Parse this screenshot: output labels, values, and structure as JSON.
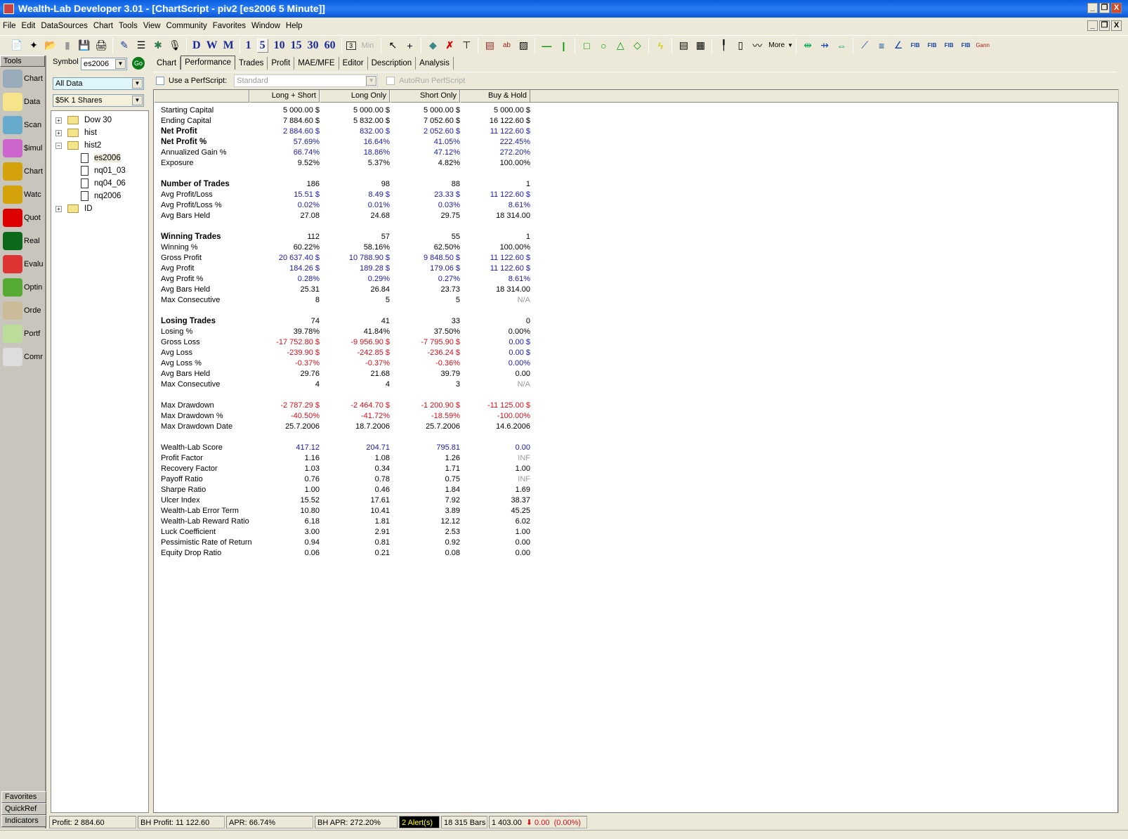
{
  "window": {
    "title": "Wealth-Lab Developer 3.01 - [ChartScript - piv2 [es2006 5 Minute]]",
    "min": "_",
    "restore": "❐",
    "close": "X"
  },
  "menu": [
    "File",
    "Edit",
    "DataSources",
    "Chart",
    "Tools",
    "View",
    "Community",
    "Favorites",
    "Window",
    "Help"
  ],
  "toolbar": {
    "timeframes": [
      "D",
      "W",
      "M",
      "1",
      "5",
      "10",
      "15",
      "30",
      "60"
    ],
    "min_label": "Min",
    "min_value": "3",
    "more_label": "More",
    "fib": "FIB",
    "gann": "Gann"
  },
  "tools": {
    "header": "Tools",
    "items": [
      "Chart",
      "Data",
      "Scan",
      "$imul",
      "Chart",
      "Watc",
      "Quot",
      "Real",
      "Evalu",
      "Optin",
      "Orde",
      "Portf",
      "Comr"
    ],
    "bottom": [
      "Favorites",
      "QuickRef",
      "Indicators"
    ]
  },
  "sidebar": {
    "symbol_label": "Symbol",
    "symbol_value": "es2006",
    "go": "Go",
    "range": "All Data",
    "sizing": "$5K 1 Shares",
    "tree": [
      {
        "label": "Dow 30",
        "type": "folder",
        "exp": "+"
      },
      {
        "label": "hist",
        "type": "folder",
        "exp": "+"
      },
      {
        "label": "hist2",
        "type": "folder",
        "exp": "−"
      },
      {
        "label": "es2006",
        "type": "doc"
      },
      {
        "label": "nq01_03",
        "type": "doc"
      },
      {
        "label": "nq04_06",
        "type": "doc"
      },
      {
        "label": "nq2006",
        "type": "doc"
      },
      {
        "label": "ID",
        "type": "folder",
        "exp": "+"
      }
    ]
  },
  "tabs": [
    "Chart",
    "Performance",
    "Trades",
    "Profit",
    "MAE/MFE",
    "Editor",
    "Description",
    "Analysis"
  ],
  "perfscript": {
    "label": "Use a PerfScript:",
    "value": "Standard",
    "autorun": "AutoRun PerfScript"
  },
  "columns": [
    "Long + Short",
    "Long Only",
    "Short Only",
    "Buy & Hold"
  ],
  "rows": [
    {
      "label": "Starting Capital",
      "vals": [
        "5 000.00 $",
        "5 000.00 $",
        "5 000.00 $",
        "5 000.00 $"
      ]
    },
    {
      "label": "Ending Capital",
      "vals": [
        "7 884.60 $",
        "5 832.00 $",
        "7 052.60 $",
        "16 122.60 $"
      ]
    },
    {
      "label": "Net Profit",
      "bold": true,
      "c": "blue",
      "vals": [
        "2 884.60 $",
        "832.00 $",
        "2 052.60 $",
        "11 122.60 $"
      ]
    },
    {
      "label": "Net Profit %",
      "bold": true,
      "c": "blue",
      "vals": [
        "57.69%",
        "16.64%",
        "41.05%",
        "222.45%"
      ]
    },
    {
      "label": "Annualized Gain %",
      "c": "blue",
      "vals": [
        "66.74%",
        "18.86%",
        "47.12%",
        "272.20%"
      ]
    },
    {
      "label": "Exposure",
      "vals": [
        "9.52%",
        "5.37%",
        "4.82%",
        "100.00%"
      ]
    },
    null,
    {
      "label": "Number of Trades",
      "bold": true,
      "vals": [
        "186",
        "98",
        "88",
        "1"
      ]
    },
    {
      "label": "Avg Profit/Loss",
      "c": "blue",
      "vals": [
        "15.51 $",
        "8.49 $",
        "23.33 $",
        "11 122.60 $"
      ]
    },
    {
      "label": "Avg Profit/Loss %",
      "c": "blue",
      "vals": [
        "0.02%",
        "0.01%",
        "0.03%",
        "8.61%"
      ]
    },
    {
      "label": "Avg Bars Held",
      "vals": [
        "27.08",
        "24.68",
        "29.75",
        "18 314.00"
      ]
    },
    null,
    {
      "label": "Winning Trades",
      "bold": true,
      "vals": [
        "112",
        "57",
        "55",
        "1"
      ]
    },
    {
      "label": "Winning %",
      "vals": [
        "60.22%",
        "58.16%",
        "62.50%",
        "100.00%"
      ]
    },
    {
      "label": "Gross Profit",
      "c": "blue",
      "vals": [
        "20 637.40 $",
        "10 788.90 $",
        "9 848.50 $",
        "11 122.60 $"
      ]
    },
    {
      "label": "Avg Profit",
      "c": "blue",
      "vals": [
        "184.26 $",
        "189.28 $",
        "179.06 $",
        "11 122.60 $"
      ]
    },
    {
      "label": "Avg Profit %",
      "c": "blue",
      "vals": [
        "0.28%",
        "0.29%",
        "0.27%",
        "8.61%"
      ]
    },
    {
      "label": "Avg Bars Held",
      "vals": [
        "25.31",
        "26.84",
        "23.73",
        "18 314.00"
      ]
    },
    {
      "label": "Max Consecutive",
      "vals": [
        "8",
        "5",
        "5",
        "N/A"
      ],
      "lastc": "gray"
    },
    null,
    {
      "label": "Losing Trades",
      "bold": true,
      "vals": [
        "74",
        "41",
        "33",
        "0"
      ]
    },
    {
      "label": "Losing %",
      "vals": [
        "39.78%",
        "41.84%",
        "37.50%",
        "0.00%"
      ]
    },
    {
      "label": "Gross Loss",
      "c": "red",
      "vals": [
        "-17 752.80 $",
        "-9 956.90 $",
        "-7 795.90 $",
        "0.00 $"
      ],
      "lastc": "blue"
    },
    {
      "label": "Avg Loss",
      "c": "red",
      "vals": [
        "-239.90 $",
        "-242.85 $",
        "-236.24 $",
        "0.00 $"
      ],
      "lastc": "blue"
    },
    {
      "label": "Avg Loss %",
      "c": "red",
      "vals": [
        "-0.37%",
        "-0.37%",
        "-0.36%",
        "0.00%"
      ],
      "lastc": "blue"
    },
    {
      "label": "Avg Bars Held",
      "vals": [
        "29.76",
        "21.68",
        "39.79",
        "0.00"
      ]
    },
    {
      "label": "Max Consecutive",
      "vals": [
        "4",
        "4",
        "3",
        "N/A"
      ],
      "lastc": "gray"
    },
    null,
    {
      "label": "Max Drawdown",
      "c": "red",
      "vals": [
        "-2 787.29 $",
        "-2 464.70 $",
        "-1 200.90 $",
        "-11 125.00 $"
      ]
    },
    {
      "label": "Max Drawdown %",
      "c": "red",
      "vals": [
        "-40.50%",
        "-41.72%",
        "-18.59%",
        "-100.00%"
      ]
    },
    {
      "label": "Max Drawdown Date",
      "vals": [
        "25.7.2006",
        "18.7.2006",
        "25.7.2006",
        "14.6.2006"
      ]
    },
    null,
    {
      "label": "Wealth-Lab Score",
      "c": "blue",
      "vals": [
        "417.12",
        "204.71",
        "795.81",
        "0.00"
      ]
    },
    {
      "label": "Profit Factor",
      "vals": [
        "1.16",
        "1.08",
        "1.26",
        "INF"
      ],
      "lastc": "gray"
    },
    {
      "label": "Recovery Factor",
      "vals": [
        "1.03",
        "0.34",
        "1.71",
        "1.00"
      ]
    },
    {
      "label": "Payoff Ratio",
      "vals": [
        "0.76",
        "0.78",
        "0.75",
        "INF"
      ],
      "lastc": "gray"
    },
    {
      "label": "Sharpe Ratio",
      "vals": [
        "1.00",
        "0.46",
        "1.84",
        "1.69"
      ]
    },
    {
      "label": "Ulcer Index",
      "vals": [
        "15.52",
        "17.61",
        "7.92",
        "38.37"
      ]
    },
    {
      "label": "Wealth-Lab Error Term",
      "vals": [
        "10.80",
        "10.41",
        "3.89",
        "45.25"
      ]
    },
    {
      "label": "Wealth-Lab Reward Ratio",
      "vals": [
        "6.18",
        "1.81",
        "12.12",
        "6.02"
      ]
    },
    {
      "label": "Luck Coefficient",
      "vals": [
        "3.00",
        "2.91",
        "2.53",
        "1.00"
      ]
    },
    {
      "label": "Pessimistic Rate of Return",
      "vals": [
        "0.94",
        "0.81",
        "0.92",
        "0.00"
      ]
    },
    {
      "label": "Equity Drop Ratio",
      "vals": [
        "0.06",
        "0.21",
        "0.08",
        "0.00"
      ]
    }
  ],
  "status": {
    "profit": "Profit: 2 884.60",
    "bh_profit": "BH Profit: 11 122.60",
    "apr": "APR: 66.74%",
    "bh_apr": "BH APR: 272.20%",
    "alerts": "2 Alert(s)",
    "bars": "18 315 Bars",
    "price": "1 403.00",
    "change": "0.00  (0.00%)"
  },
  "colors": {
    "blue": "#1a1aa8",
    "red": "#d40f1a",
    "title": "#0a5fe0"
  }
}
